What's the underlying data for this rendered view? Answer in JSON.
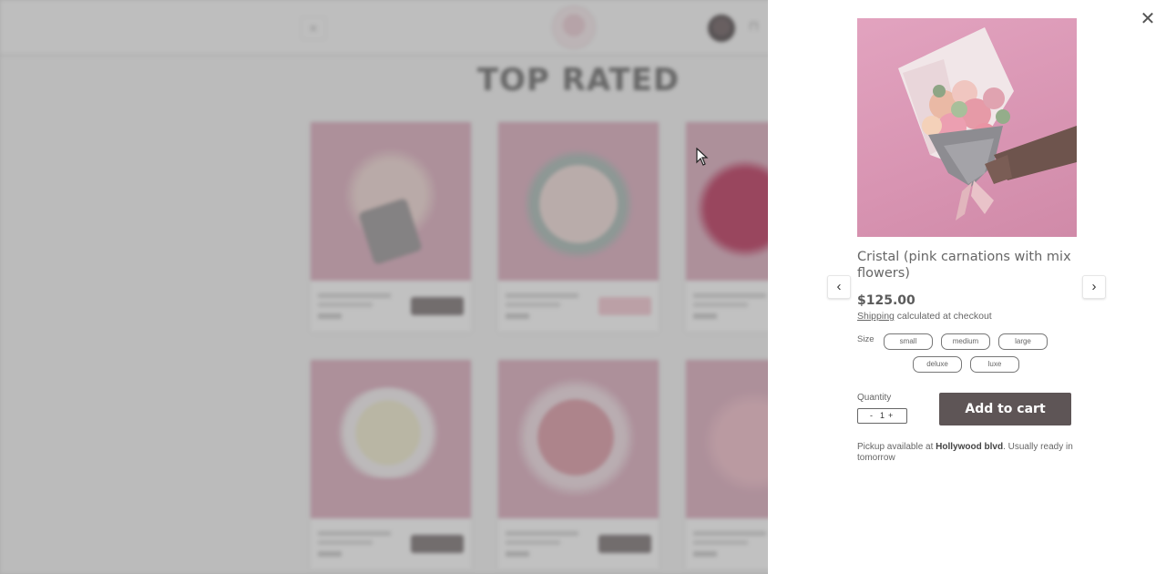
{
  "background": {
    "heading": "TOP RATED",
    "menu_icon": "hamburger-icon",
    "cart_icon": "bag-icon",
    "cards": [
      {
        "tone": "#d9a4b7",
        "flower": "#efd3cf",
        "button": "dark"
      },
      {
        "tone": "#d9a4b7",
        "flower": "#efd8d4",
        "button": "pink"
      },
      {
        "tone": "#d9a4b7",
        "flower": "#b51e4a",
        "button": "none"
      },
      {
        "tone": "#d9a4b7",
        "flower": "#eeeac8",
        "button": "dark"
      },
      {
        "tone": "#d9a4b7",
        "flower": "#d98f9c",
        "button": "dark"
      },
      {
        "tone": "#d9a4b7",
        "flower": "#f0b7c4",
        "button": "none"
      }
    ]
  },
  "drawer": {
    "close_icon": "close-icon",
    "prev_icon": "chevron-left-icon",
    "next_icon": "chevron-right-icon",
    "product": {
      "title": "Cristal (pink carnations with mix flowers)",
      "price": "$125.00",
      "shipping_link": "Shipping",
      "shipping_suffix": "calculated at checkout",
      "size_label": "Size",
      "sizes": [
        "small",
        "medium",
        "large",
        "deluxe",
        "luxe"
      ],
      "quantity_label": "Quantity",
      "quantity_minus": "-",
      "quantity_value": "1",
      "quantity_plus": "+",
      "add_to_cart_label": "Add to cart",
      "pickup_prefix": "Pickup available at",
      "pickup_location": "Hollywood blvd",
      "pickup_suffix": ". Usually ready in tomorrow"
    }
  },
  "colors": {
    "accent_button": "#5e5556",
    "product_bg_pink": "#d894b2"
  }
}
